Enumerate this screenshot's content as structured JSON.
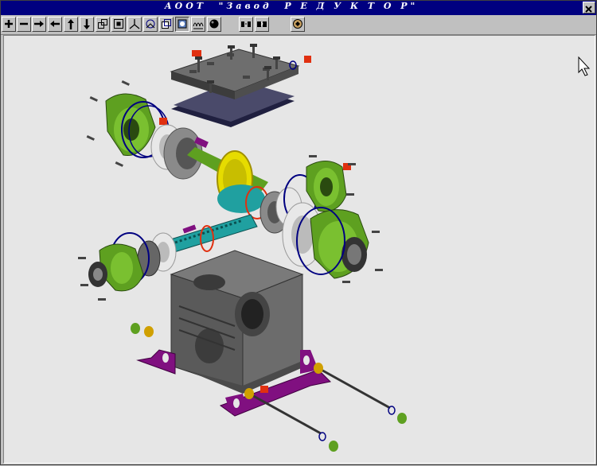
{
  "window": {
    "title": "АООТ  \"Завод  Р Е Д У К Т О Р\""
  },
  "toolbar": {
    "buttons": [
      {
        "name": "zoom-in-icon"
      },
      {
        "name": "zoom-out-icon"
      },
      {
        "name": "pan-right-icon"
      },
      {
        "name": "pan-left-icon"
      },
      {
        "name": "pan-up-icon"
      },
      {
        "name": "pan-down-icon"
      },
      {
        "name": "zoom-window-icon"
      },
      {
        "name": "fit-all-icon"
      },
      {
        "name": "axes-view-icon"
      },
      {
        "name": "rotate-view-icon"
      },
      {
        "name": "copy-view-icon"
      },
      {
        "name": "shaded-view-icon"
      },
      {
        "name": "wireframe-view-icon"
      },
      {
        "name": "render-sphere-icon"
      },
      {
        "name": "explode-icon"
      },
      {
        "name": "assemble-icon"
      },
      {
        "name": "animate-icon"
      }
    ]
  },
  "colors": {
    "title_bar": "#000080",
    "viewport": "#e6e6e6",
    "housing": "#666666",
    "cover_green": "#5ea020",
    "gear_yellow": "#e6dc00",
    "shaft_cyan": "#20a0a0",
    "base_purple": "#801080",
    "seal_red": "#e03010"
  }
}
